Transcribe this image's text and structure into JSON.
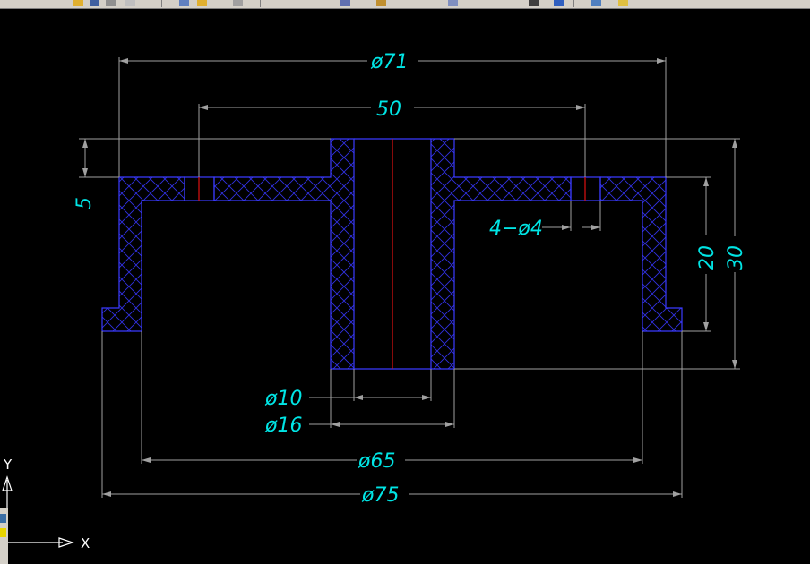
{
  "drawing": {
    "dimensions": {
      "d71": "ø71",
      "d50": "50",
      "d5": "5",
      "d4x4": "4−ø4",
      "d20": "20",
      "d30": "30",
      "d10": "ø10",
      "d16": "ø16",
      "d65": "ø65",
      "d75": "ø75"
    },
    "ucs": {
      "x_label": "X",
      "y_label": "Y"
    },
    "colors": {
      "outline": "#3b3bff",
      "hatch": "#3030e0",
      "centerline": "#e01010",
      "dimension": "#a0a0a0",
      "dim_text": "#00e5e5",
      "background": "#000000"
    }
  },
  "toolbar": {
    "icons": [
      "open-icon",
      "save-icon",
      "print-icon",
      "undo-icon",
      "redo-icon",
      "pan-icon",
      "zoom-icon",
      "properties-icon",
      "layers-icon"
    ]
  }
}
